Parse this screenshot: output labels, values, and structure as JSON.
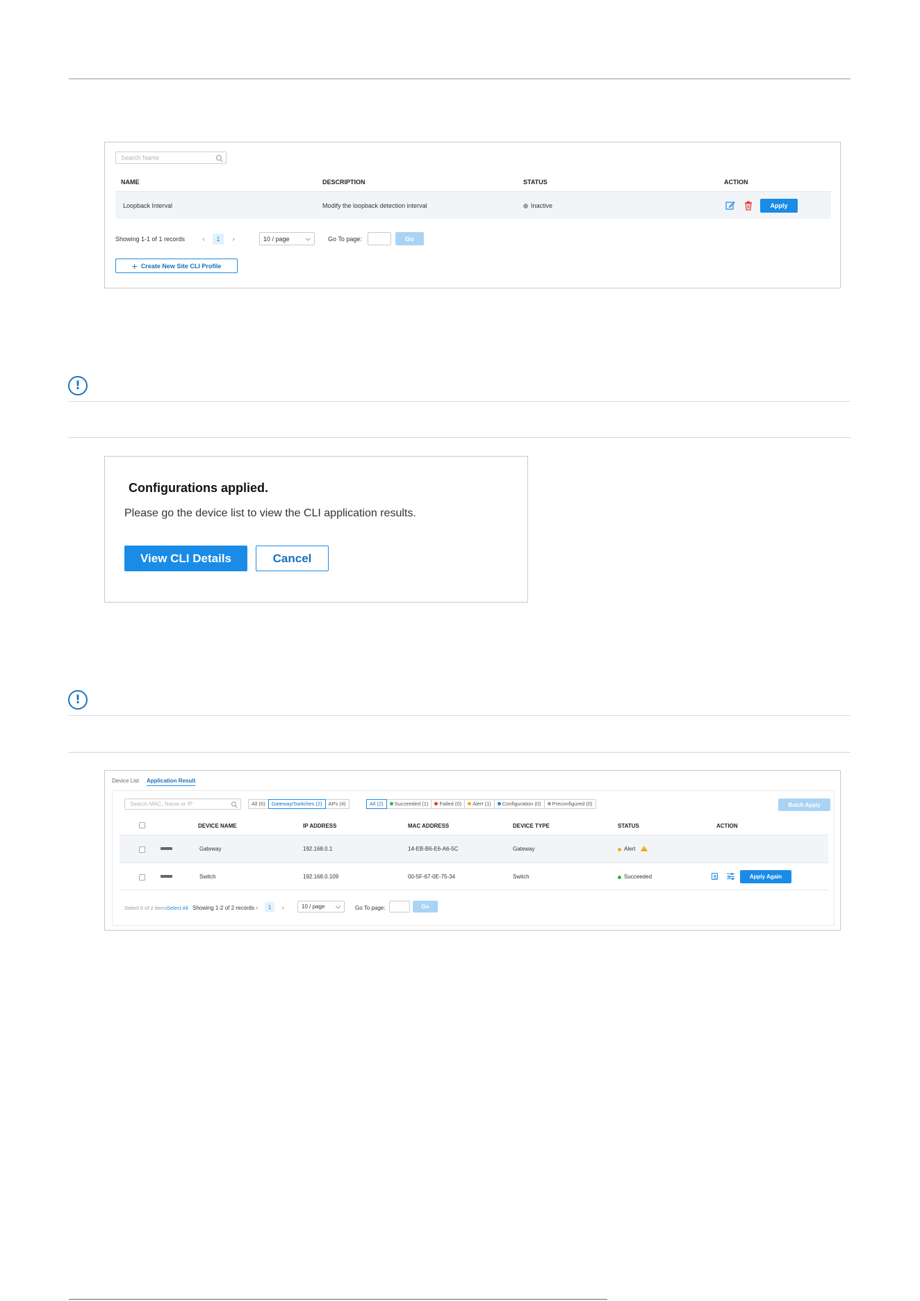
{
  "colors": {
    "accent": "#1a8be6",
    "inactive": "#9e9e9e",
    "succeeded": "#2db34a",
    "failed": "#e53935",
    "alert": "#f5a623",
    "configuration": "#1a8be6",
    "preconfigured": "#9e9e9e",
    "delete": "#e53935"
  },
  "profiles": {
    "search_placeholder": "Search Name",
    "columns": [
      "NAME",
      "DESCRIPTION",
      "STATUS",
      "ACTION"
    ],
    "rows": [
      {
        "name": "Loopback Interval",
        "description": "Modify the loopback detection interval",
        "status": "Inactive",
        "apply_label": "Apply",
        "icons": [
          "edit-icon",
          "delete-icon"
        ]
      }
    ],
    "pager": {
      "summary": "Showing 1-1 of 1 records",
      "prev": "‹",
      "page": "1",
      "next": "›",
      "per_page": "10 / page",
      "goto_label": "Go To page:",
      "go_label": "Go"
    },
    "create_button": "Create New Site CLI Profile",
    "create_icon": "+"
  },
  "note_icon_glyph": "!",
  "dialog": {
    "title": "Configurations applied.",
    "message": "Please go the device list to view the CLI application results.",
    "primary_button": "View CLI Details",
    "cancel_button": "Cancel"
  },
  "results": {
    "tabs": [
      "Device List",
      "Application Result"
    ],
    "search_placeholder": "Search MAC, Name or IP",
    "device_filters": [
      "All (6)",
      "Gateway/Switches (2)",
      "APs (4)"
    ],
    "status_filters": [
      "All (2)",
      "Succeeded (1)",
      "Failed (0)",
      "Alert (1)",
      "Configuration (0)",
      "Preconfigured (0)"
    ],
    "batch_apply": "Batch Apply",
    "columns": [
      "DEVICE NAME",
      "IP ADDRESS",
      "MAC ADDRESS",
      "DEVICE TYPE",
      "STATUS",
      "ACTION"
    ],
    "rows": [
      {
        "name": "Gateway",
        "ip": "192.168.0.1",
        "mac": "14-EB-B6-E6-A6-5C",
        "type": "Gateway",
        "status": "Alert"
      },
      {
        "name": "Switch",
        "ip": "192.168.0.109",
        "mac": "00-5F-67-0E-75-34",
        "type": "Switch",
        "status": "Succeeded",
        "apply_again": "Apply Again",
        "icons": [
          "details-icon",
          "settings-icon"
        ]
      }
    ],
    "footer": {
      "selection": "Select 0 of 2 items",
      "select_all": "Select All",
      "summary": "Showing 1-2 of 2 records",
      "prev": "‹",
      "page": "1",
      "next": "›",
      "per_page": "10 / page",
      "goto_label": "Go To page:",
      "go_label": "Go"
    }
  }
}
